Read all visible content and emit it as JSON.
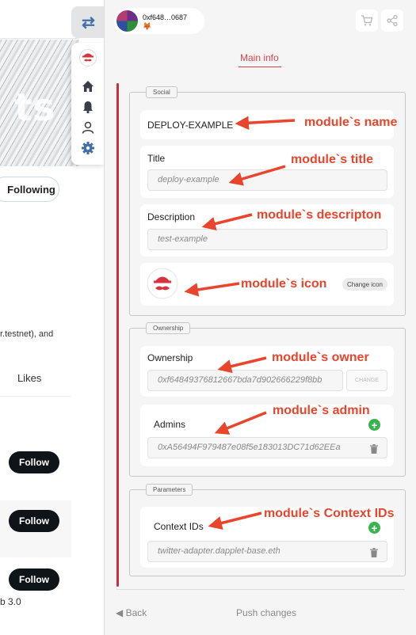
{
  "background": {
    "banner_text": "ts",
    "following_label": "Following",
    "description_fragment": "r.testnet), and",
    "likes_tab": "Likes",
    "follow_label": "Follow",
    "web3_fragment": "b 3.0"
  },
  "account": {
    "address": "0xf648…0687",
    "wallet_icon": "metamask-fox-icon"
  },
  "toolbar": {
    "cart_icon": "cart-icon",
    "share_icon": "share-icon"
  },
  "tabs": {
    "main": "Main info"
  },
  "social": {
    "legend": "Social",
    "name": "DEPLOY-EXAMPLE",
    "title_label": "Title",
    "title_value": "deploy-example",
    "description_label": "Description",
    "description_value": "test-example",
    "change_icon_label": "Change icon"
  },
  "ownership": {
    "legend": "Ownership",
    "ownership_label": "Ownership",
    "owner_value": "0xf64849376812667bda7d902666229f8bb",
    "change_label": "CHANGE",
    "admins_label": "Admins",
    "admin_value": "0xA56494F979487e08f5e183013DC71d62EEa"
  },
  "parameters": {
    "legend": "Parameters",
    "context_label": "Context IDs",
    "context_value": "twitter-adapter.dapplet-base.eth"
  },
  "footer": {
    "back_label": "Back",
    "push_label": "Push changes"
  },
  "annotations": {
    "name": "module`s name",
    "title": "module`s title",
    "description": "module`s descripton",
    "icon": "module`s icon",
    "owner": "module`s owner",
    "admin": "module`s admin",
    "context": "module`s Context IDs"
  },
  "colors": {
    "accent": "#d9434c",
    "annotation": "#e8452c",
    "add": "#38b34d",
    "tab_icon": "#3e6fa8"
  }
}
